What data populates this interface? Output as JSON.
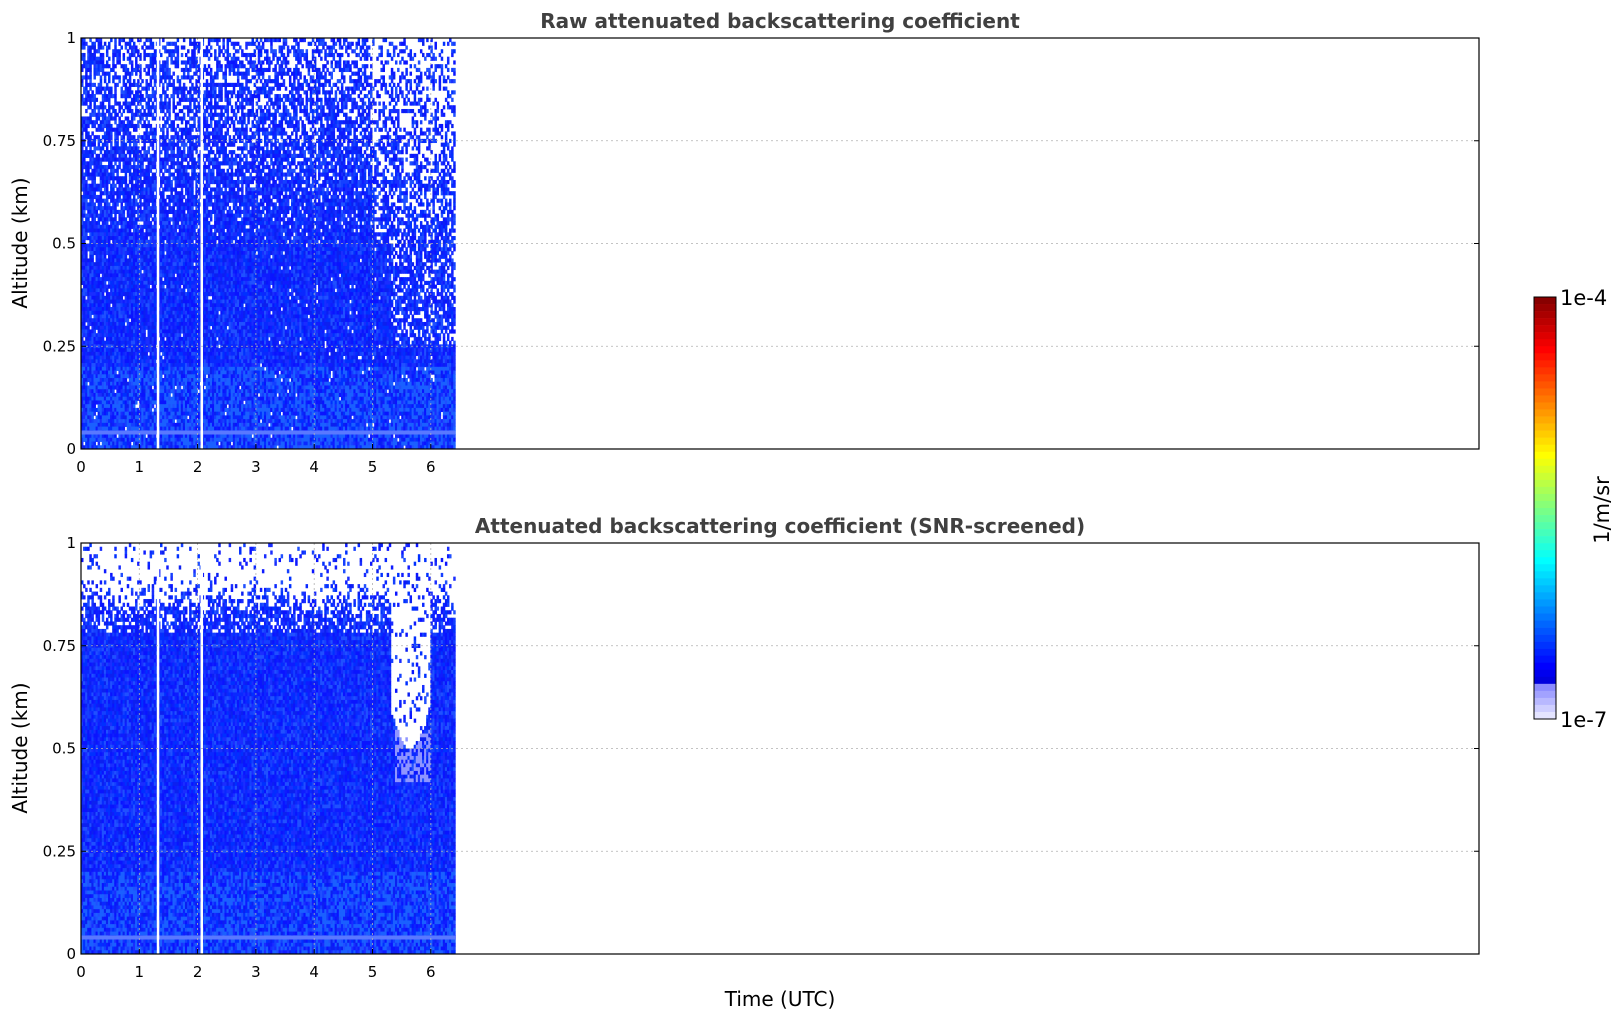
{
  "chart_data": [
    {
      "type": "heatmap",
      "title": "Raw attenuated backscattering coefficient",
      "xlabel": "",
      "ylabel": "Altitude (km)",
      "xlim": [
        0,
        24
      ],
      "ylim": [
        0,
        1
      ],
      "xticks": [
        0,
        1,
        2,
        3,
        4,
        5,
        6
      ],
      "xtick_labels": [
        "0",
        "1",
        "2",
        "3",
        "4",
        "5",
        "6"
      ],
      "yticks": [
        0,
        0.25,
        0.5,
        0.75,
        1
      ],
      "ytick_labels": [
        "0",
        "0.25",
        "0.5",
        "0.75",
        "1"
      ],
      "grid": true,
      "data_time_range": [
        0,
        6.42
      ],
      "gaps_at_time": [
        1.3,
        2.05
      ],
      "description_colormap": "jet, log scale"
    },
    {
      "type": "heatmap",
      "title": "Attenuated backscattering coefficient (SNR-screened)",
      "xlabel": "Time (UTC)",
      "ylabel": "Altitude (km)",
      "xlim": [
        0,
        24
      ],
      "ylim": [
        0,
        1
      ],
      "xticks": [
        0,
        1,
        2,
        3,
        4,
        5,
        6
      ],
      "xtick_labels": [
        "0",
        "1",
        "2",
        "3",
        "4",
        "5",
        "6"
      ],
      "yticks": [
        0,
        0.25,
        0.5,
        0.75,
        1
      ],
      "ytick_labels": [
        "0",
        "0.25",
        "0.5",
        "0.75",
        "1"
      ],
      "grid": true,
      "data_time_range": [
        0,
        6.42
      ],
      "gaps_at_time": [
        1.3,
        2.05
      ]
    }
  ],
  "colorbar": {
    "min_label": "1e-7",
    "max_label": "1e-4",
    "label": "1/m/sr",
    "scale": "log",
    "colormap": "jet"
  },
  "colors": {
    "dominant_signal": "#0a14ff",
    "title_color": "#404040",
    "grid_color": "#b0b0b0"
  }
}
